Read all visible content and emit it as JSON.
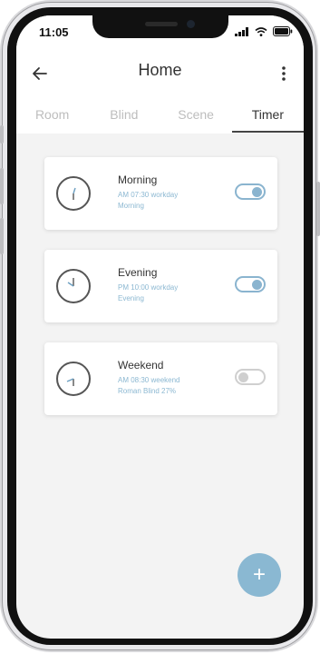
{
  "status": {
    "time": "11:05"
  },
  "header": {
    "title": "Home"
  },
  "tabs": [
    {
      "label": "Room",
      "active": false
    },
    {
      "label": "Blind",
      "active": false
    },
    {
      "label": "Scene",
      "active": false
    },
    {
      "label": "Timer",
      "active": true
    }
  ],
  "timers": [
    {
      "name": "Morning",
      "schedule": "AM 07:30 workday",
      "target": "Morning",
      "enabled": true
    },
    {
      "name": "Evening",
      "schedule": "PM 10:00 workday",
      "target": "Evening",
      "enabled": true
    },
    {
      "name": "Weekend",
      "schedule": "AM 08:30 weekend",
      "target": "Roman Blind 27%",
      "enabled": false
    }
  ],
  "fab": {
    "label": "+"
  },
  "colors": {
    "accent": "#8ab4cf",
    "fab": "#8ab8d2",
    "subtext": "#8cb8d2"
  },
  "icons": [
    "back-arrow-icon",
    "more-vert-icon",
    "clock-icon",
    "signal-icon",
    "wifi-icon",
    "battery-icon"
  ]
}
